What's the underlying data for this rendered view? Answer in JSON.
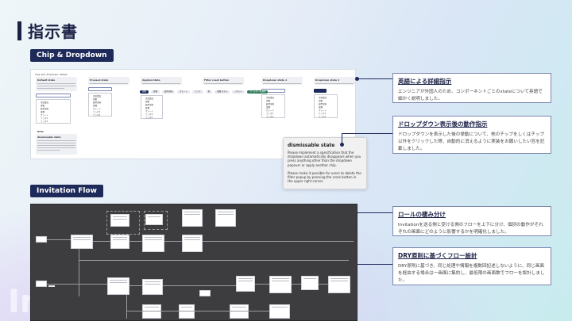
{
  "page": {
    "title": "指示書",
    "watermark": "In"
  },
  "sections": {
    "chip_dropdown": "Chip & Dropdown",
    "invitation_flow": "Invitation Flow"
  },
  "mockup": {
    "panel_header": "Chip and dropdown: States",
    "cards": [
      {
        "title": "Default state"
      },
      {
        "title": "Pressed state"
      },
      {
        "title": "Applied state"
      },
      {
        "title": "Filter reset button"
      },
      {
        "title": "Dropdown state 1"
      },
      {
        "title": "Dropdown state 2"
      }
    ],
    "note_title": "Note",
    "note_heading": "dismissable state",
    "dropdown_items": [
      "全従業員",
      "部署",
      "雇用形態",
      "役職",
      "グレード",
      "ランク1",
      "ランク2"
    ],
    "chips": [
      "部署",
      "役職",
      "雇用形態",
      "グレード",
      "ランク",
      "他",
      "役職 スキル",
      "リセット",
      "フィルターを適用"
    ]
  },
  "popup": {
    "title": "dismissable state",
    "body1": "Please implement a specification that the dropdown automatically disappears when you press anything other than the dropdown popover or apply another chip.",
    "body2": "Please make it possible for users to delete the filter popup by pressing the cross button in the upper right corner."
  },
  "notes": [
    {
      "title": "英語による詳細指示",
      "body": "エンジニアが外国人のため、コンポーネントごとのstateについて英語で細かく説明しました。"
    },
    {
      "title": "ドロップダウン表示後の動作指示",
      "body": "ドロップダウンを表示した後の挙動について、他のチップをしくはチップ以外をクリックした際、自動的に消えるように実装をお願いしたい旨を記載しました。"
    },
    {
      "title": "ロールの棲み分け",
      "body": "Invitationを送る側と受ける側のフローを上下に分け、個別の動作がそれぞれの画面にどのように影響するかを明確化しました。"
    },
    {
      "title": "DRY原則に基づくフロー設計",
      "body": "DRY原則に基づき、同じ処理や情報を複数回記述しないように、同じ画面を経由する場合は一画面に集約し、最低限の画面数でフローを設計しました。"
    }
  ],
  "colors": {
    "navy": "#1e2a5a",
    "dark_panel": "#3d3d3f"
  }
}
